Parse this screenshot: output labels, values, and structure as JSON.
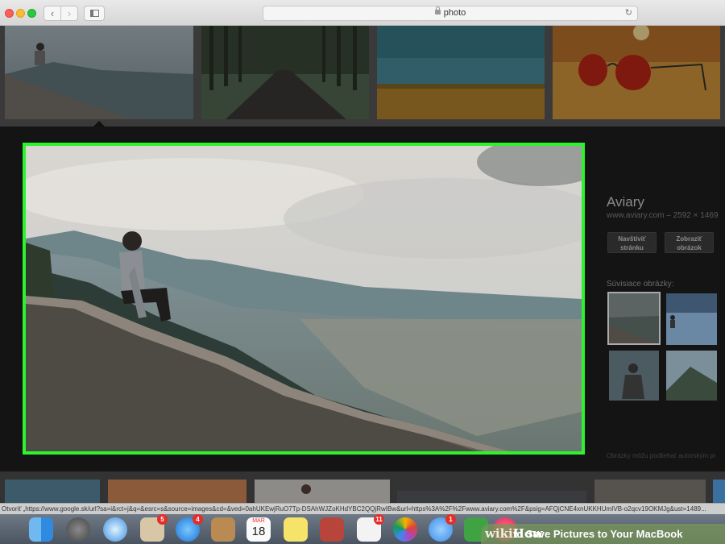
{
  "browser": {
    "address_text": "photo",
    "back_icon": "chevron-left-icon",
    "forward_icon": "chevron-right-icon",
    "reload_icon": "reload-icon"
  },
  "preview": {
    "site_name": "Aviary",
    "site_meta": "www.aviary.com – 2592 × 1469",
    "visit_page_label": "Navštíviť\nstránku",
    "view_image_label": "Zobraziť\nobrázok",
    "related_label": "Súvisiace obrázky:",
    "copyright_note": "Obrázky môžu podliehať autorským pr"
  },
  "status_url": "Otvoriť „https://www.google.sk/url?sa=i&rct=j&q=&esrc=s&source=images&cd=&ved=0ahUKEwjRuO7Tp-DSAhWJZoKHdYBC2QQjRwIBw&url=https%3A%2F%2Fwww.aviary.com%2F&psig=AFQjCNE4xnUKKHUmIVB-o2qcv19OKMJg&ust=1489...",
  "dock": {
    "items": [
      {
        "name": "finder-icon"
      },
      {
        "name": "launchpad-icon"
      },
      {
        "name": "safari-icon"
      },
      {
        "name": "mail-stamp-icon",
        "badge": "5"
      },
      {
        "name": "app-store-icon",
        "badge": "4"
      },
      {
        "name": "contacts-icon"
      },
      {
        "name": "calendar-icon",
        "month": "MAR",
        "day": "18"
      },
      {
        "name": "notes-icon"
      },
      {
        "name": "photo-booth-icon"
      },
      {
        "name": "reminders-icon",
        "badge": "11"
      },
      {
        "name": "photos-icon"
      },
      {
        "name": "messages-icon",
        "badge": "1"
      },
      {
        "name": "facetime-icon"
      },
      {
        "name": "itunes-icon"
      }
    ]
  },
  "watermark": {
    "logo_wiki": "wiki",
    "logo_how": "How",
    "title": "to Save Pictures to Your MacBook"
  },
  "colors": {
    "highlight": "#2ef22e",
    "panel_bg": "#141414"
  }
}
